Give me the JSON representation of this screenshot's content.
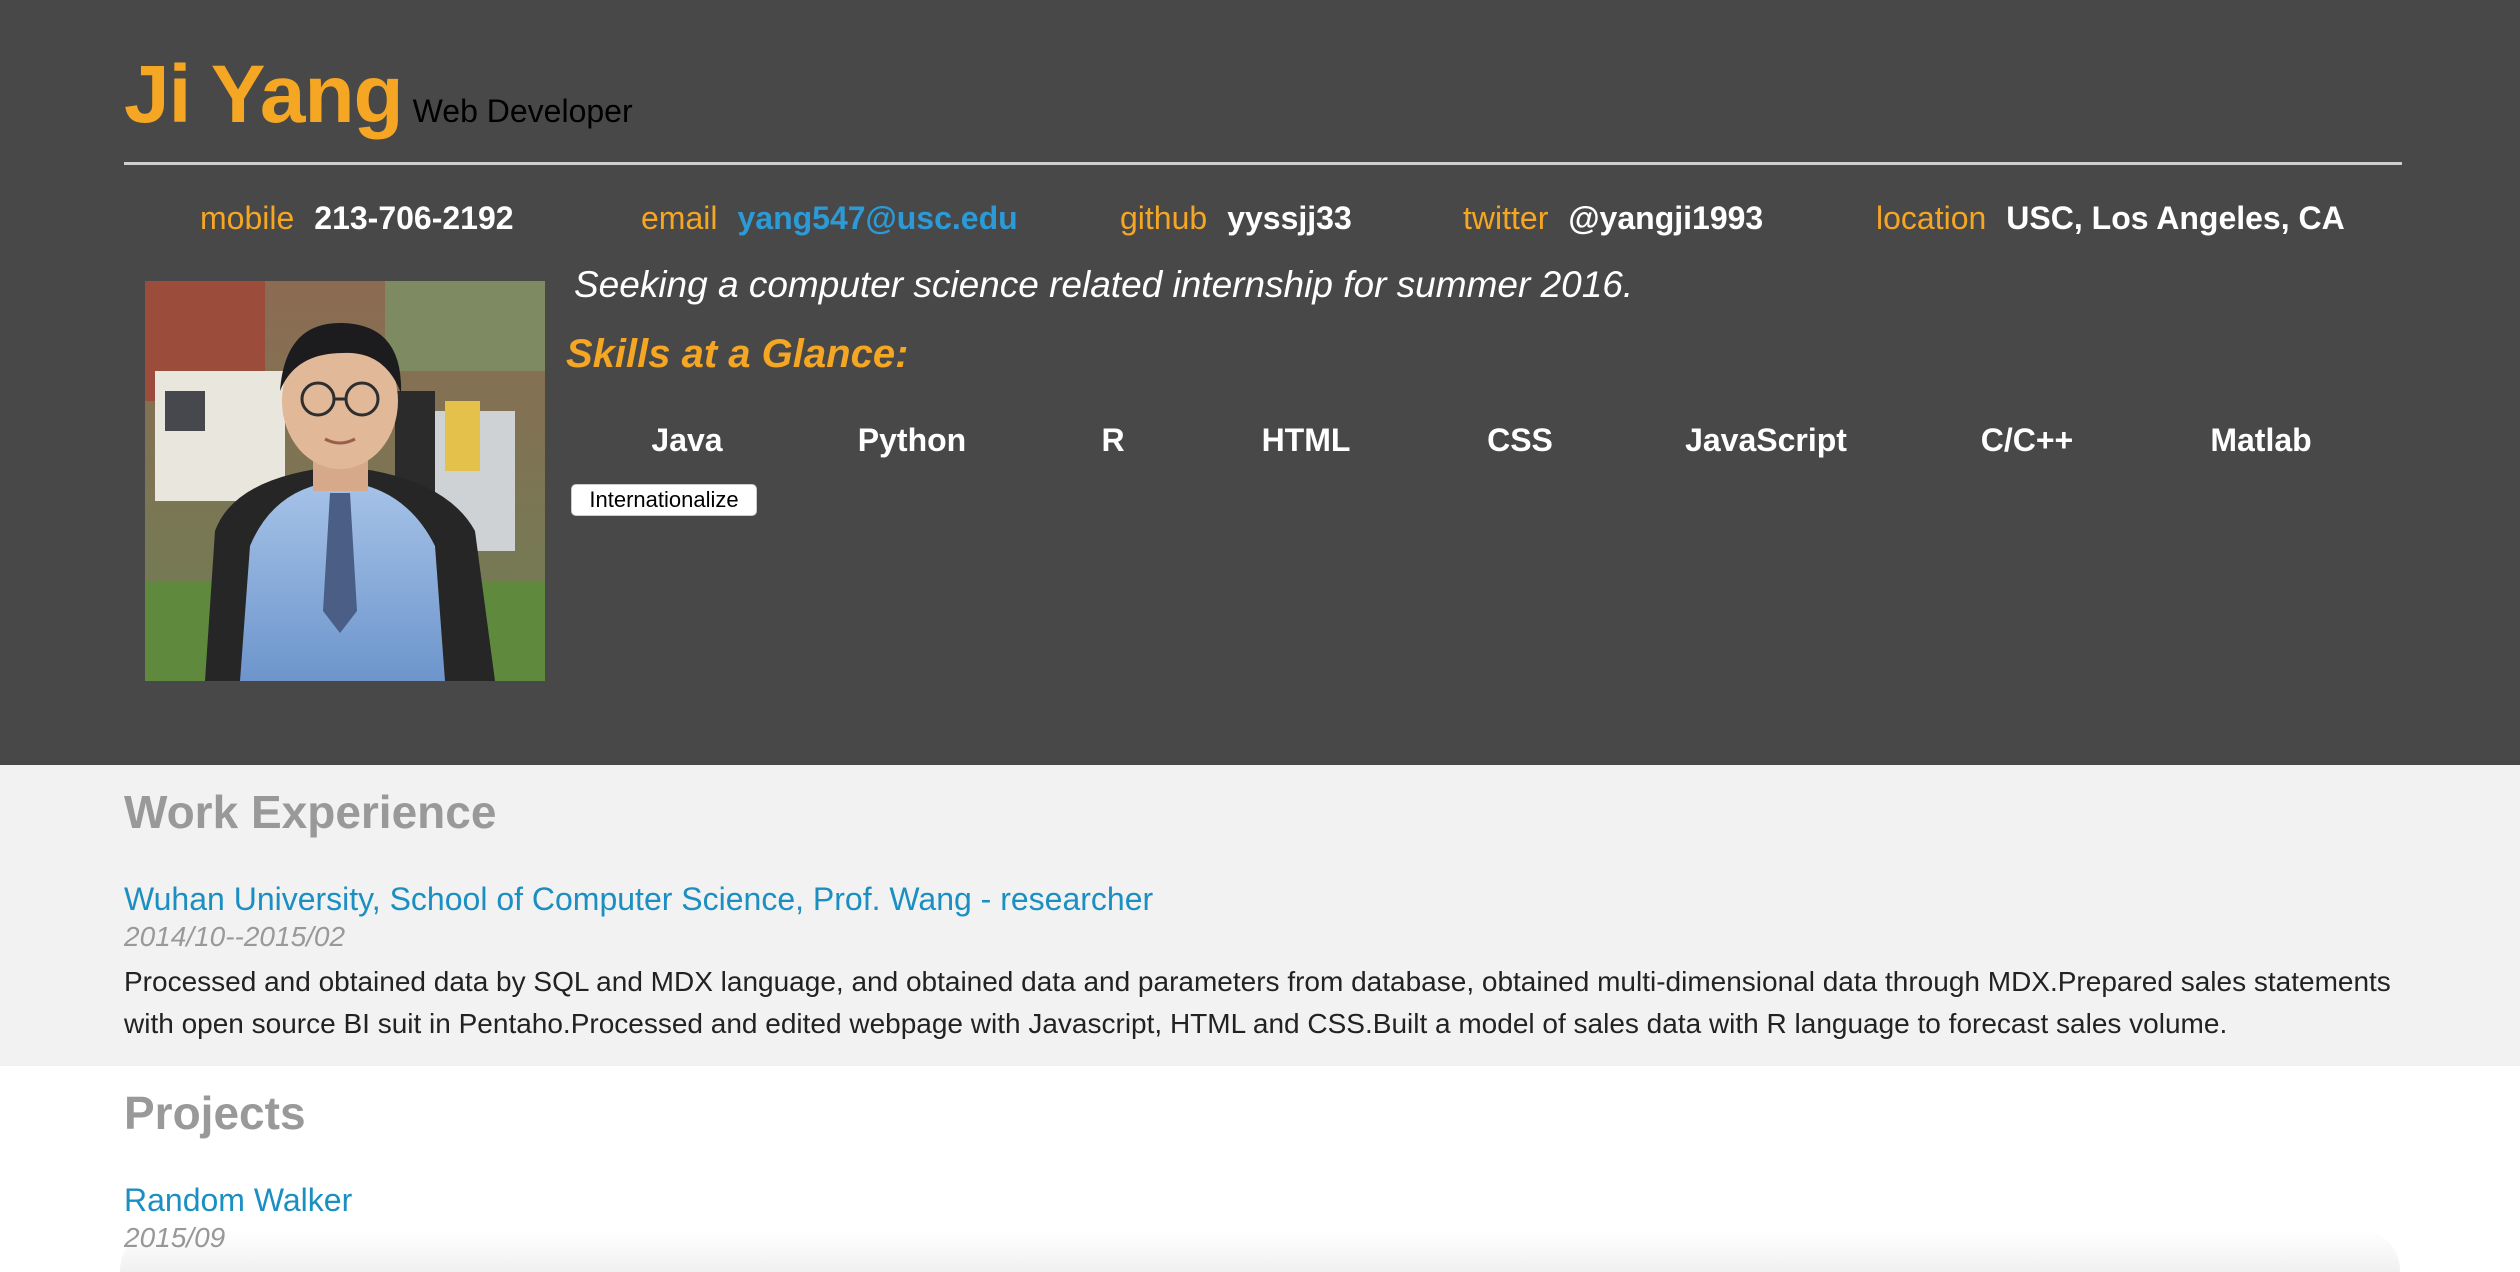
{
  "header": {
    "name": "Ji Yang",
    "role": "Web Developer",
    "contacts": [
      {
        "label": "mobile",
        "value": "213-706-2192"
      },
      {
        "label": "email",
        "value": "yang547@usc.edu"
      },
      {
        "label": "github",
        "value": "yyssjj33"
      },
      {
        "label": "twitter",
        "value": "@yangji1993"
      },
      {
        "label": "location",
        "value": "USC, Los Angeles, CA"
      }
    ],
    "objective": "Seeking a computer science related internship for summer 2016.",
    "skills_title": "Skills at a Glance:",
    "skills": [
      "Java",
      "Python",
      "R",
      "HTML",
      "CSS",
      "JavaScript",
      "C/C++",
      "Matlab"
    ],
    "button_label": "Internationalize"
  },
  "work": {
    "title": "Work Experience",
    "entries": [
      {
        "title": "Wuhan University, School of Computer Science, Prof. Wang - researcher",
        "date": "2014/10--2015/02",
        "description": "Processed and obtained data by SQL and MDX language, and obtained data and parameters from database, obtained multi-dimensional data through MDX.Prepared sales statements with open source BI suit in Pentaho.Processed and edited webpage with Javascript, HTML and CSS.Built a model of sales data with R language to forecast sales volume."
      }
    ]
  },
  "projects": {
    "title": "Projects",
    "entries": [
      {
        "title": "Random Walker",
        "date": "2015/09"
      }
    ]
  },
  "colors": {
    "header_bg": "#484848",
    "accent": "#f5a623",
    "link": "#1b8fc2",
    "work_bg": "#f2f2f2"
  }
}
